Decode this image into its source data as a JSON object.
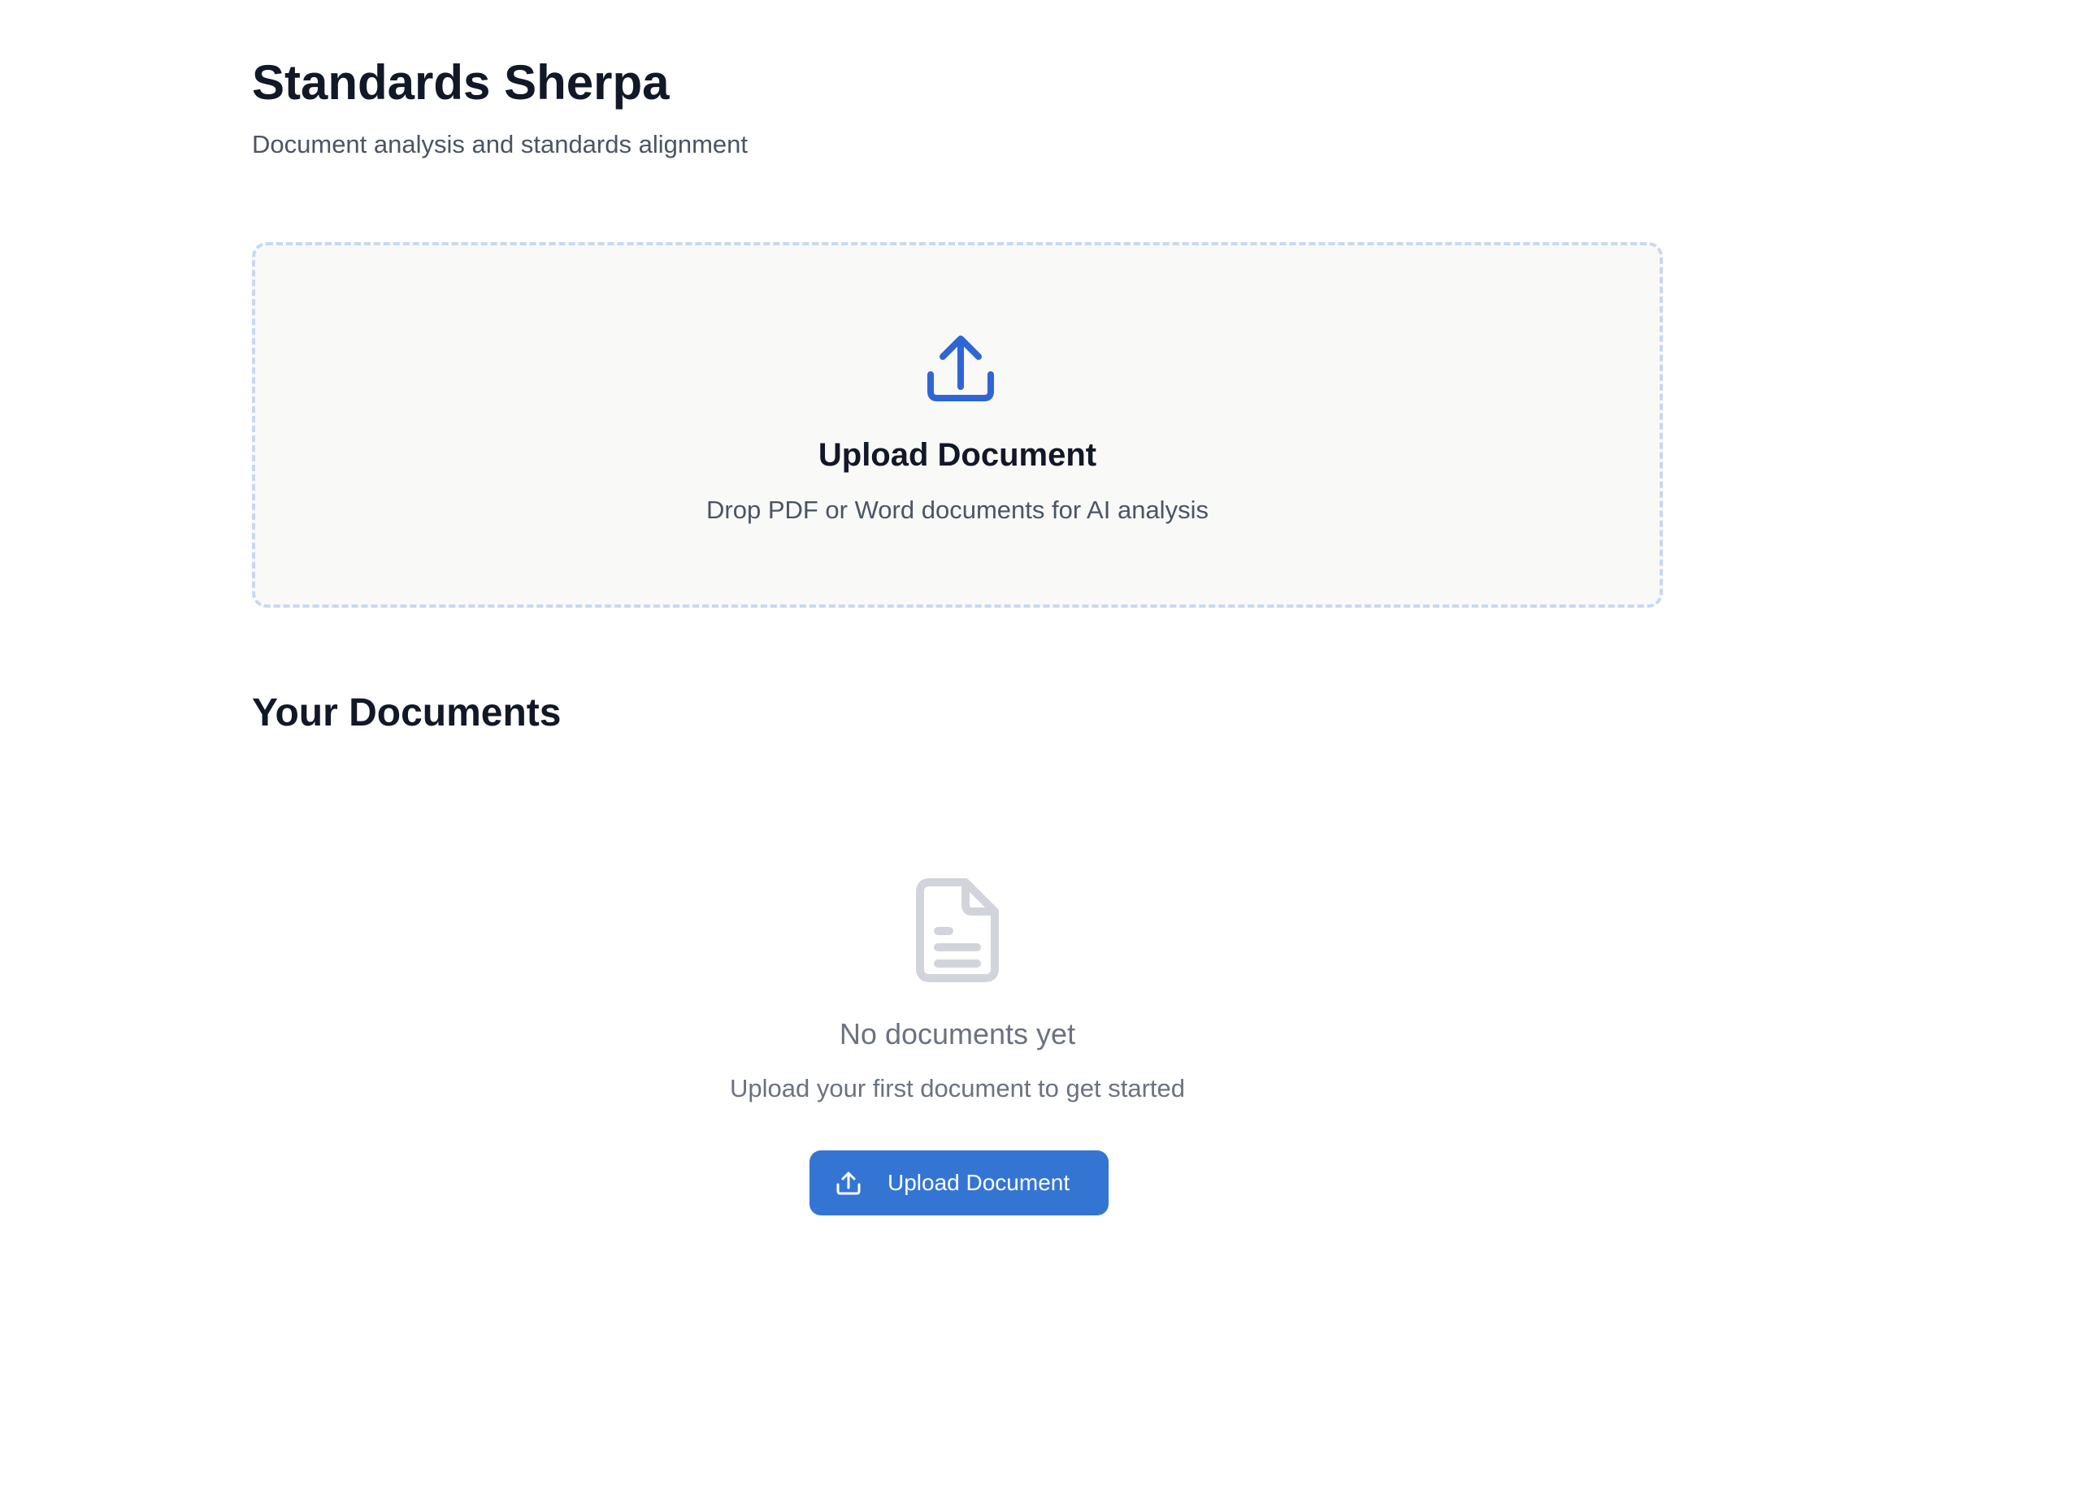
{
  "header": {
    "title": "Standards Sherpa",
    "subtitle": "Document analysis and standards alignment"
  },
  "dropzone": {
    "icon": "upload-icon",
    "title": "Upload Document",
    "description": "Drop PDF or Word documents for AI analysis"
  },
  "documents": {
    "section_title": "Your Documents",
    "empty_state": {
      "icon": "file-text-icon",
      "title": "No documents yet",
      "description": "Upload your first document to get started",
      "button_label": "Upload Document",
      "button_icon": "upload-icon"
    }
  },
  "colors": {
    "accent": "#3475d4",
    "icon_blue": "#2f66d5",
    "empty_icon_gray": "#d1d5db",
    "dropzone_border": "#c6d9f3",
    "dropzone_bg": "#f9f9f8",
    "heading": "#111827",
    "muted_text": "#4b5563"
  }
}
